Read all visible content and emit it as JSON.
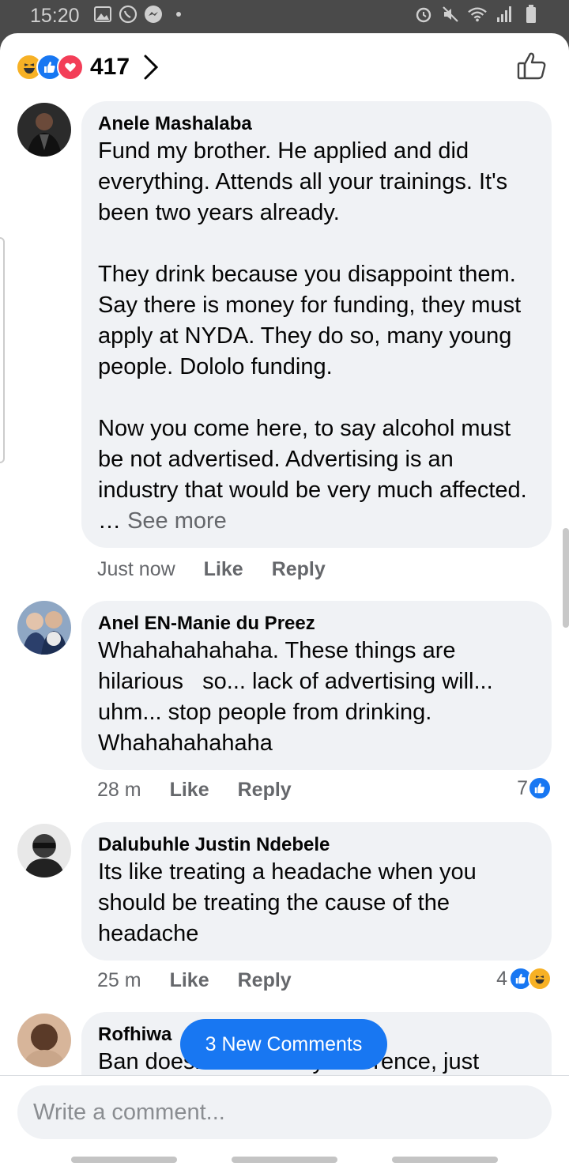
{
  "status_bar": {
    "time": "15:20"
  },
  "header": {
    "reaction_count": "417"
  },
  "comments": [
    {
      "author": "Anele Mashalaba",
      "text": "Fund my brother. He applied and did everything. Attends all your trainings. It's been two years already.\n\nThey drink because you disappoint them. Say there is money for funding, they must apply at NYDA. They do so, many young people. Dololo funding.\n\nNow you come here, to say alcohol must be not advertised. Advertising is an industry that would be very much affected. …",
      "see_more": "See more",
      "time": "Just now",
      "like": "Like",
      "reply": "Reply"
    },
    {
      "author": "Anel EN-Manie du Preez",
      "text": "Whahahahahaha. These things are hilarious   so... lack of advertising will... uhm... stop people from drinking. Whahahahahaha",
      "time": "28 m",
      "like": "Like",
      "reply": "Reply",
      "reactions": "7"
    },
    {
      "author": "Dalubuhle Justin Ndebele",
      "text": "Its like treating a headache when you should be treating the cause of the headache",
      "time": "25 m",
      "like": "Like",
      "reply": "Reply",
      "reactions": "4"
    },
    {
      "author": "Rofhiwa",
      "text": "Ban doesn't make any difference, just"
    }
  ],
  "new_comments_pill": "3 New Comments",
  "composer": {
    "placeholder": "Write a comment..."
  },
  "colors": {
    "brand_blue": "#1877f2",
    "bubble": "#f0f2f5",
    "secondary_text": "#65676b"
  }
}
